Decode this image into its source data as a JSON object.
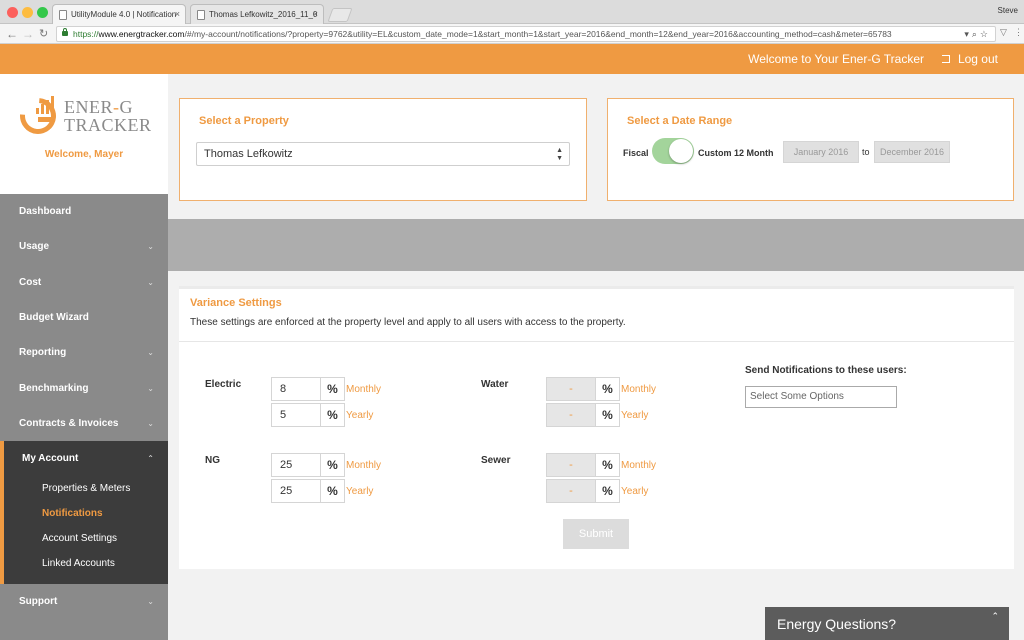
{
  "browser": {
    "tabs": [
      {
        "title": "UtilityModule 4.0 | Notification"
      },
      {
        "title": "Thomas Lefkowitz_2016_11_0"
      }
    ],
    "profile": "Steve",
    "url": {
      "scheme": "https://",
      "host": "www.energtracker.com",
      "rest": "/#/my-account/notifications/?property=9762&utility=EL&custom_date_mode=1&start_month=1&start_year=2016&end_month=12&end_year=2016&accounting_method=cash&meter=65783"
    }
  },
  "header": {
    "welcome": "Welcome to Your Ener-G Tracker",
    "logout": "Log out"
  },
  "brand": {
    "line1_a": "ENER",
    "line1_hyphen": "-",
    "line1_b": "G",
    "line2": "TRACKER",
    "welcome_user": "Welcome, Mayer"
  },
  "sidebar": {
    "items": [
      {
        "label": "Dashboard"
      },
      {
        "label": "Usage",
        "chevron": "⌄"
      },
      {
        "label": "Cost",
        "chevron": "⌄"
      },
      {
        "label": "Budget Wizard"
      },
      {
        "label": "Reporting",
        "chevron": "⌄"
      },
      {
        "label": "Benchmarking",
        "chevron": "⌄"
      },
      {
        "label": "Contracts & Invoices",
        "chevron": "⌄"
      },
      {
        "label": "My Account",
        "chevron": "⌃"
      },
      {
        "label": "Support",
        "chevron": "⌄"
      }
    ],
    "sub_items": [
      {
        "label": "Properties & Meters"
      },
      {
        "label": "Notifications"
      },
      {
        "label": "Account Settings"
      },
      {
        "label": "Linked Accounts"
      }
    ]
  },
  "property": {
    "title": "Select a Property",
    "selected": "Thomas Lefkowitz"
  },
  "date_range": {
    "title": "Select a Date Range",
    "fiscal_label": "Fiscal",
    "custom_label": "Custom 12 Month",
    "start": "January 2016",
    "to": "to",
    "end": "December 2016",
    "toggle_on": true
  },
  "variance": {
    "title": "Variance Settings",
    "description": "These settings are enforced at the property level and apply to all users with access to the property.",
    "pct": "%",
    "monthly": "Monthly",
    "yearly": "Yearly",
    "electric": {
      "label": "Electric",
      "monthly": "8",
      "yearly": "5"
    },
    "ng": {
      "label": "NG",
      "monthly": "25",
      "yearly": "25"
    },
    "water": {
      "label": "Water",
      "monthly": "-",
      "yearly": "-"
    },
    "sewer": {
      "label": "Sewer",
      "monthly": "-",
      "yearly": "-"
    },
    "notify_label": "Send Notifications to these users:",
    "notify_placeholder": "Select Some Options",
    "submit": "Submit"
  },
  "chat": {
    "label": "Energy Questions?",
    "caret": "⌃"
  },
  "colors": {
    "accent": "#ef9a42",
    "sidebar": "#8a8a8a",
    "sidebar_active": "#3c3c3c",
    "toggle_on": "#a3d49b"
  }
}
